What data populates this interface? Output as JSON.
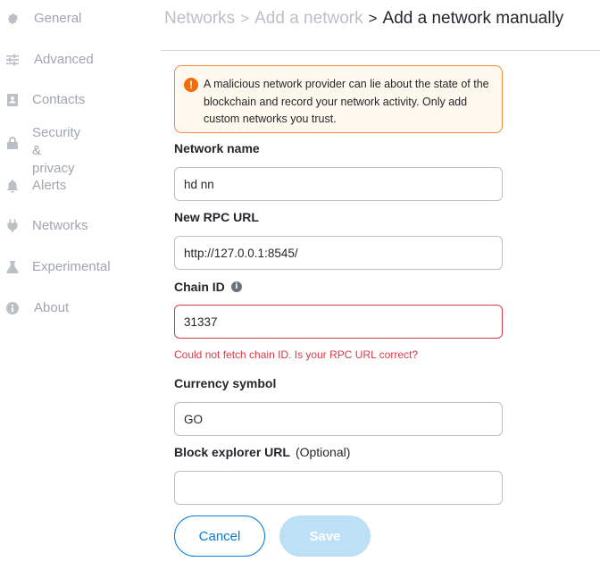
{
  "sidebar": {
    "items": [
      {
        "label": "General",
        "icon": "gear-icon"
      },
      {
        "label": "Advanced",
        "icon": "sliders-icon"
      },
      {
        "label": "Contacts",
        "icon": "contact-book-icon"
      },
      {
        "label": "Security &\nprivacy",
        "icon": "lock-icon"
      },
      {
        "label": "Alerts",
        "icon": "bell-icon"
      },
      {
        "label": "Networks",
        "icon": "plug-icon"
      },
      {
        "label": "Experimental",
        "icon": "flask-icon"
      },
      {
        "label": "About",
        "icon": "info-icon"
      }
    ]
  },
  "header": {
    "crumb1": "Networks",
    "crumb2": "Add a network",
    "current": "Add a network manually"
  },
  "warning": {
    "icon": "!",
    "text": "A malicious network provider can lie about the state of the blockchain and record your network activity. Only add custom networks you trust."
  },
  "form": {
    "network_name": {
      "label": "Network name",
      "value": "hd nn"
    },
    "rpc_url": {
      "label": "New RPC URL",
      "value": "http://127.0.0.1:8545/"
    },
    "chain_id": {
      "label": "Chain ID",
      "value": "31337",
      "info_icon": "i",
      "error": "Could not fetch chain ID. Is your RPC URL correct?"
    },
    "currency_symbol": {
      "label": "Currency symbol",
      "value": "GO"
    },
    "block_explorer": {
      "label": "Block explorer URL",
      "optional": "(Optional)",
      "value": ""
    }
  },
  "buttons": {
    "cancel": "Cancel",
    "save": "Save"
  },
  "colors": {
    "accent": "#037dd6",
    "error": "#d73a49",
    "warning_border": "#f8883b",
    "warning_bg": "#fef8ee",
    "save_disabled": "#bde0f7"
  }
}
